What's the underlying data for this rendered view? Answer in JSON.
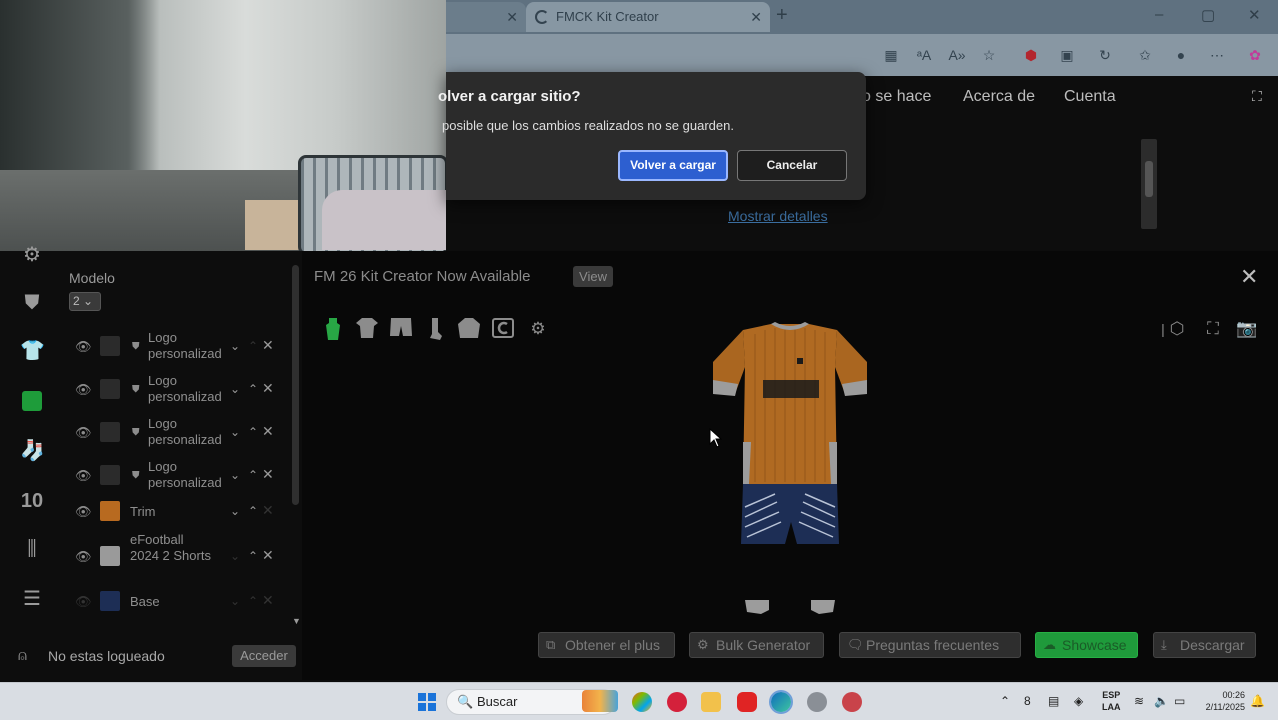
{
  "browser": {
    "tabs": [
      {
        "title": ""
      },
      {
        "title": "FMCK Kit Creator"
      }
    ],
    "new_tab": "+",
    "window_controls": [
      "–",
      "▢",
      "✕"
    ]
  },
  "site_nav": {
    "links": [
      "o se hace",
      "Acerca de",
      "Cuenta"
    ]
  },
  "notice": {
    "details_link": "Mostrar detalles"
  },
  "dialog": {
    "title": "olver a cargar sitio?",
    "message": "posible que los cambios realizados no se guarden.",
    "confirm_label": "Volver a cargar",
    "cancel_label": "Cancelar"
  },
  "rail": {
    "number_label": "10"
  },
  "layers_panel": {
    "modelo_label": "Modelo",
    "modelo_value": "2",
    "layers": [
      {
        "name": "Logo personalizad",
        "swatch": "#2b2b2b",
        "shield": true
      },
      {
        "name": "Logo personalizad",
        "swatch": "#2b2b2b",
        "shield": true
      },
      {
        "name": "Logo personalizad",
        "swatch": "#2b2b2b",
        "shield": true
      },
      {
        "name": "Logo personalizad",
        "swatch": "#2b2b2b",
        "shield": true
      },
      {
        "name": "Trim",
        "swatch": "#b86a20",
        "shield": false
      },
      {
        "name": "eFootball 2024 2 Shorts",
        "swatch": "#9a9a9a",
        "shield": false
      },
      {
        "name": "Base",
        "swatch": "#1d2e55",
        "shield": false
      }
    ]
  },
  "login": {
    "status_text": "No estas logueado",
    "button_label": "Acceder"
  },
  "banner": {
    "text": "FM 26 Kit Creator Now Available",
    "view_label": "View",
    "close": "✕"
  },
  "actions": [
    {
      "label": "Obtener el plus",
      "icon": "external-link-icon"
    },
    {
      "label": "Bulk Generator",
      "icon": "gear-icon"
    },
    {
      "label": "Preguntas frecuentes",
      "icon": "chat-icon"
    },
    {
      "label": "Showcase",
      "icon": "cloud-icon"
    },
    {
      "label": "Descargar",
      "icon": "download-icon"
    }
  ],
  "taskbar": {
    "search_label": "Buscar",
    "lang_line1": "ESP",
    "lang_line2": "LAA",
    "time": "00:26",
    "date": "2/11/2025"
  },
  "colors": {
    "accent_green": "#28a745",
    "dialog_primary": "#2d5fd0",
    "kit_orange": "#b86a20",
    "kit_navy": "#1d2e55"
  }
}
